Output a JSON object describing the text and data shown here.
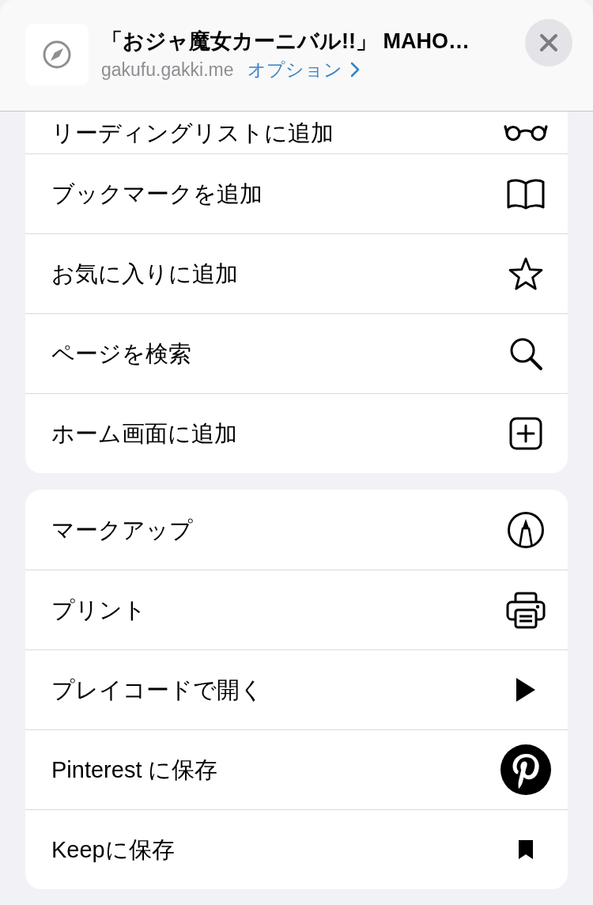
{
  "header": {
    "title": "「おジャ魔女カーニバル!!」 MAHO…",
    "url": "gakufu.gakki.me",
    "options_link": "オプション"
  },
  "sections": [
    {
      "actions": [
        {
          "label": "リーディングリストに追加",
          "kind": "glasses"
        },
        {
          "label": "ブックマークを追加",
          "kind": "book"
        },
        {
          "label": "お気に入りに追加",
          "kind": "star"
        },
        {
          "label": "ページを検索",
          "kind": "search"
        },
        {
          "label": "ホーム画面に追加",
          "kind": "plussquare"
        }
      ]
    },
    {
      "actions": [
        {
          "label": "マークアップ",
          "kind": "pen"
        },
        {
          "label": "プリント",
          "kind": "printer"
        },
        {
          "label": "プレイコードで開く",
          "kind": "play"
        },
        {
          "label": "Pinterest に保存",
          "kind": "plogo"
        },
        {
          "label": "Keepに保存",
          "kind": "ribbon"
        }
      ]
    }
  ]
}
